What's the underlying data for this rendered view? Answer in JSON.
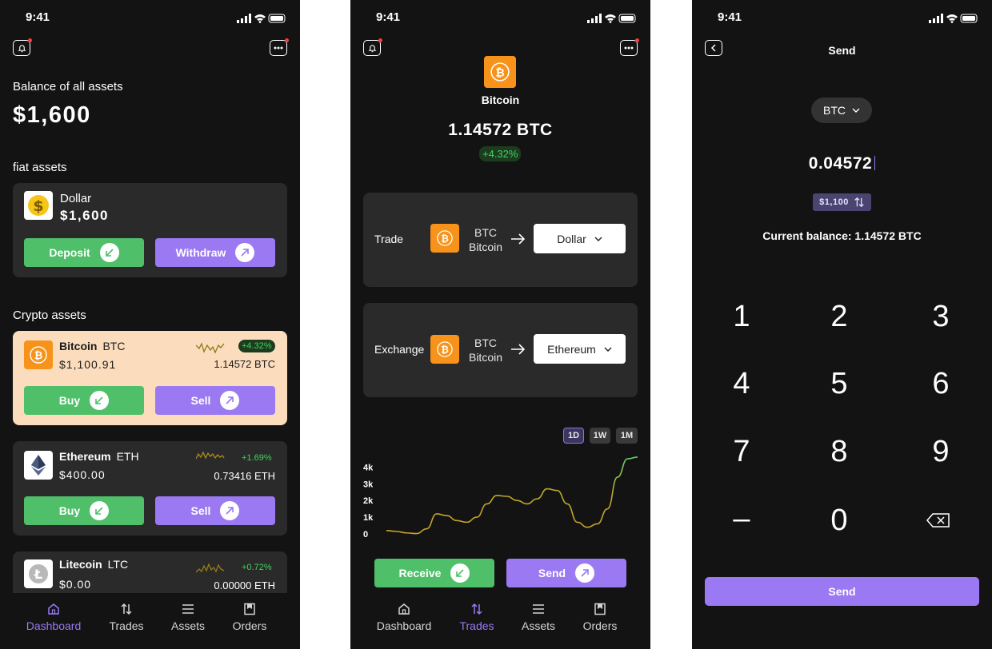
{
  "status": {
    "time": "9:41"
  },
  "dashboard": {
    "balance_label": "Balance of all assets",
    "balance_value": "$1,600",
    "fiat_label": "fiat assets",
    "fiat": {
      "name": "Dollar",
      "value": "$1,600",
      "deposit": "Deposit",
      "withdraw": "Withdraw"
    },
    "crypto_label": "Crypto assets",
    "coins": [
      {
        "name": "Bitcoin",
        "symbol": "BTC",
        "value": "$1,100.91",
        "change": "+4.32%",
        "amount": "1.14572 BTC",
        "buy": "Buy",
        "sell": "Sell"
      },
      {
        "name": "Ethereum",
        "symbol": "ETH",
        "value": "$400.00",
        "change": "+1.69%",
        "amount": "0.73416 ETH",
        "buy": "Buy",
        "sell": "Sell"
      },
      {
        "name": "Litecoin",
        "symbol": "LTC",
        "value": "$0.00",
        "change": "+0.72%",
        "amount": "0.00000 ETH"
      }
    ]
  },
  "tabs": [
    "Dashboard",
    "Trades",
    "Assets",
    "Orders"
  ],
  "trades": {
    "coin_name": "Bitcoin",
    "amount": "1.14572 BTC",
    "change": "+4.32%",
    "trade_label": "Trade",
    "exchange_label": "Exchange",
    "from_symbol": "BTC",
    "from_name": "Bitcoin",
    "trade_target": "Dollar",
    "exchange_target": "Ethereum",
    "ranges": [
      "1D",
      "1W",
      "1M"
    ],
    "receive": "Receive",
    "send": "Send"
  },
  "chart_data": {
    "type": "line",
    "y_ticks": [
      "0",
      "1k",
      "2k",
      "3k",
      "4k"
    ],
    "ylim": [
      0,
      4500
    ],
    "values": [
      200,
      150,
      60,
      20,
      300,
      1200,
      1100,
      800,
      700,
      1000,
      1800,
      2300,
      2250,
      2000,
      1800,
      2100,
      2700,
      2600,
      1800,
      700,
      400,
      600,
      1500,
      3400,
      4500,
      4600
    ],
    "colors": {
      "low": "#c9a227",
      "high": "#63d36a"
    }
  },
  "send": {
    "title": "Send",
    "currency": "BTC",
    "amount": "0.04572",
    "fiat": "$1,100",
    "balance": "Current balance: 1.14572 BTC",
    "keys": [
      "1",
      "2",
      "3",
      "4",
      "5",
      "6",
      "7",
      "8",
      "9",
      "–",
      "0"
    ],
    "button": "Send"
  },
  "colors": {
    "accent": "#9b79f2",
    "green": "#4fbf6a",
    "btc": "#f7931a",
    "bg": "#131313",
    "card": "#2a2a2a",
    "highlight": "#fbdcbc"
  }
}
